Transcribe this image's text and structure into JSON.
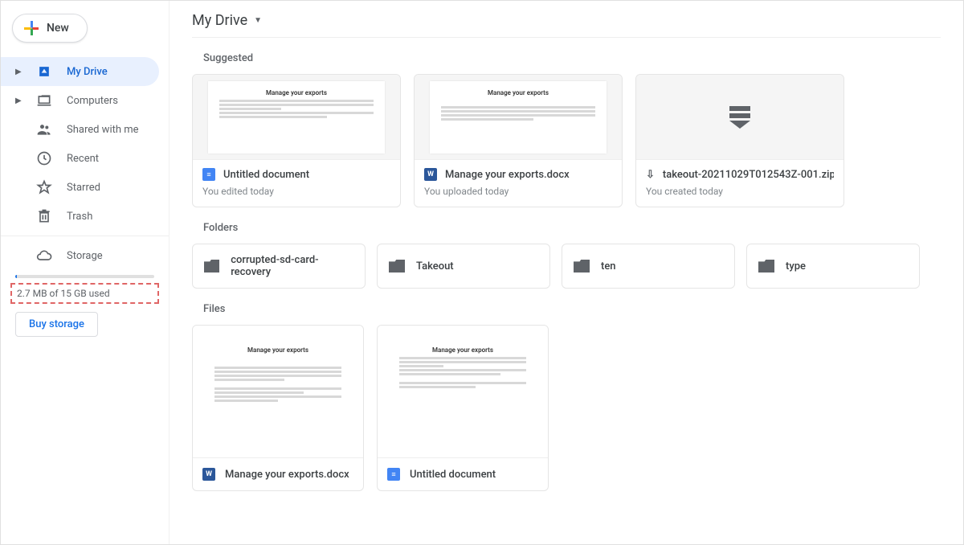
{
  "new_button": {
    "label": "New"
  },
  "sidebar": {
    "items": [
      {
        "label": "My Drive"
      },
      {
        "label": "Computers"
      },
      {
        "label": "Shared with me"
      },
      {
        "label": "Recent"
      },
      {
        "label": "Starred"
      },
      {
        "label": "Trash"
      }
    ],
    "storage_label": "Storage",
    "storage_text": "2.7 MB of 15 GB used",
    "buy_label": "Buy storage"
  },
  "breadcrumb": {
    "title": "My Drive"
  },
  "suggested": {
    "heading": "Suggested",
    "items": [
      {
        "title": "Untitled document",
        "subtitle": "You edited today",
        "thumb_heading": "Manage your exports",
        "icon_letter": "≡"
      },
      {
        "title": "Manage your exports.docx",
        "subtitle": "You uploaded today",
        "thumb_heading": "Manage your exports",
        "icon_letter": "W"
      },
      {
        "title": "takeout-20211029T012543Z-001.zip",
        "subtitle": "You created today",
        "icon_letter": "⇩"
      }
    ]
  },
  "folders": {
    "heading": "Folders",
    "items": [
      {
        "label": "corrupted-sd-card-recovery"
      },
      {
        "label": "Takeout"
      },
      {
        "label": "ten"
      },
      {
        "label": "type"
      }
    ]
  },
  "files": {
    "heading": "Files",
    "items": [
      {
        "title": "Manage your exports.docx",
        "thumb_heading": "Manage your exports",
        "icon_letter": "W"
      },
      {
        "title": "Untitled document",
        "thumb_heading": "Manage your exports",
        "icon_letter": "≡"
      }
    ]
  }
}
